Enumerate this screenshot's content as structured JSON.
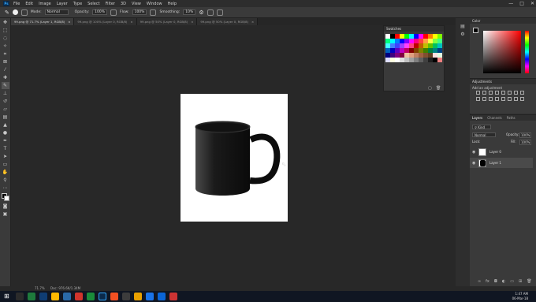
{
  "app": {
    "logo": "Ps"
  },
  "menu": [
    "File",
    "Edit",
    "Image",
    "Layer",
    "Type",
    "Select",
    "Filter",
    "3D",
    "View",
    "Window",
    "Help"
  ],
  "window_controls": {
    "minimize": "—",
    "maximize": "□",
    "close": "✕"
  },
  "options": {
    "mode_label": "Mode:",
    "mode_value": "Normal",
    "opacity_label": "Opacity:",
    "opacity_value": "100%",
    "flow_label": "Flow:",
    "flow_value": "100%",
    "smoothing_label": "Smoothing:",
    "smoothing_value": "10%"
  },
  "tabs": [
    {
      "label": "99.png @ 71.7% (Layer 1, RGB/8)",
      "close": "×"
    },
    {
      "label": "99.png @ 100% (Layer 0, RGB/8)",
      "close": "×"
    },
    {
      "label": "99.png @ 50% (Layer 0, RGB/8)",
      "close": "×"
    },
    {
      "label": "99.png @ 50% (Layer 0, RGB/8)",
      "close": "×"
    }
  ],
  "status": {
    "zoom": "71.7%",
    "doc": "Doc: 976.6K/1.34M"
  },
  "swatches": {
    "title": "Swatches",
    "colors": [
      "#ffffff",
      "#000000",
      "#ff0000",
      "#ffff00",
      "#00ff00",
      "#00ffff",
      "#0000ff",
      "#ff00ff",
      "#ff0000",
      "#ff8000",
      "#ffff00",
      "#80ff00",
      "#00ff80",
      "#00ffff",
      "#0080ff",
      "#0000ff",
      "#8000ff",
      "#ff00ff",
      "#ff0080",
      "#ff4040",
      "#ffa040",
      "#ffff40",
      "#80ff40",
      "#40ff80",
      "#40ffff",
      "#4080ff",
      "#4040ff",
      "#a040ff",
      "#ff40ff",
      "#ff4080",
      "#c00000",
      "#c06000",
      "#c0c000",
      "#60c000",
      "#00c060",
      "#00c0c0",
      "#0060c0",
      "#0000c0",
      "#6000c0",
      "#c000c0",
      "#c00060",
      "#800000",
      "#804000",
      "#808000",
      "#408000",
      "#008040",
      "#008080",
      "#004080",
      "#000080",
      "#400080",
      "#800080",
      "#800040",
      "#f0c0a0",
      "#e0a080",
      "#c08060",
      "#a06040",
      "#805030",
      "#604020",
      "#ffe0e0",
      "#e0ffe0",
      "#e0e0ff",
      "#ffffe0",
      "#ffffff",
      "#e0e0e0",
      "#c0c0c0",
      "#a0a0a0",
      "#808080",
      "#606060",
      "#404040",
      "#202020",
      "#000000",
      "#f08080"
    ]
  },
  "color_panel": {
    "title": "Color"
  },
  "adjustments": {
    "title": "Adjustments",
    "subtitle": "Add an adjustment"
  },
  "layers": {
    "tabs": [
      "Layers",
      "Channels",
      "Paths"
    ],
    "kind_label": "Kind",
    "blend": "Normal",
    "opacity_label": "Opacity:",
    "opacity_value": "100%",
    "lock_label": "Lock:",
    "fill_label": "Fill:",
    "fill_value": "100%",
    "items": [
      {
        "name": "Layer 0"
      },
      {
        "name": "Layer 1"
      }
    ]
  },
  "clock": {
    "time": "1:47 AM",
    "date": "06-Mar-18"
  },
  "taskbar_colors": [
    "#2b2b2b",
    "#1e7a3c",
    "#0f3d74",
    "#ffb900",
    "#2a6aa8",
    "#d0342c",
    "#1a8c3a",
    "#0b2a4a",
    "#f25022",
    "#3c3c3c",
    "#e8a000",
    "#1a73e8",
    "#0a64d6",
    "#cc3333"
  ]
}
